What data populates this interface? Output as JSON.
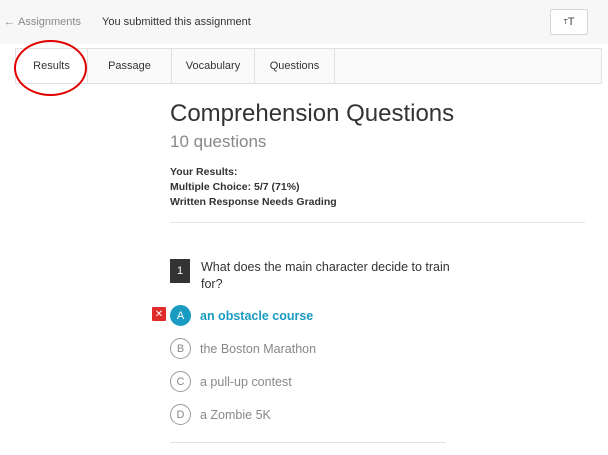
{
  "topbar": {
    "back_arrow": "←",
    "back_label": "Assignments",
    "status": "You submitted this assignment",
    "font_button_small": "T",
    "font_button_large": "T"
  },
  "tabs": [
    {
      "label": "Results",
      "active": true
    },
    {
      "label": "Passage",
      "active": false
    },
    {
      "label": "Vocabulary",
      "active": false
    },
    {
      "label": "Questions",
      "active": false
    }
  ],
  "main": {
    "title": "Comprehension Questions",
    "question_count": "10 questions",
    "results": {
      "heading": "Your Results:",
      "multiple_choice": "Multiple Choice: 5/7 (71%)",
      "written": "Written Response Needs Grading"
    }
  },
  "question": {
    "number": "1",
    "text": "What does the main character decide to train for?",
    "wrong_marker": "✕",
    "options": [
      {
        "letter": "A",
        "text": "an obstacle course",
        "selected": true
      },
      {
        "letter": "B",
        "text": "the Boston Marathon",
        "selected": false
      },
      {
        "letter": "C",
        "text": "a pull-up contest",
        "selected": false
      },
      {
        "letter": "D",
        "text": "a Zombie 5K",
        "selected": false
      }
    ]
  },
  "colors": {
    "accent": "#1a9bc2",
    "wrong": "#e02b2b",
    "annotation": "#e00000"
  }
}
